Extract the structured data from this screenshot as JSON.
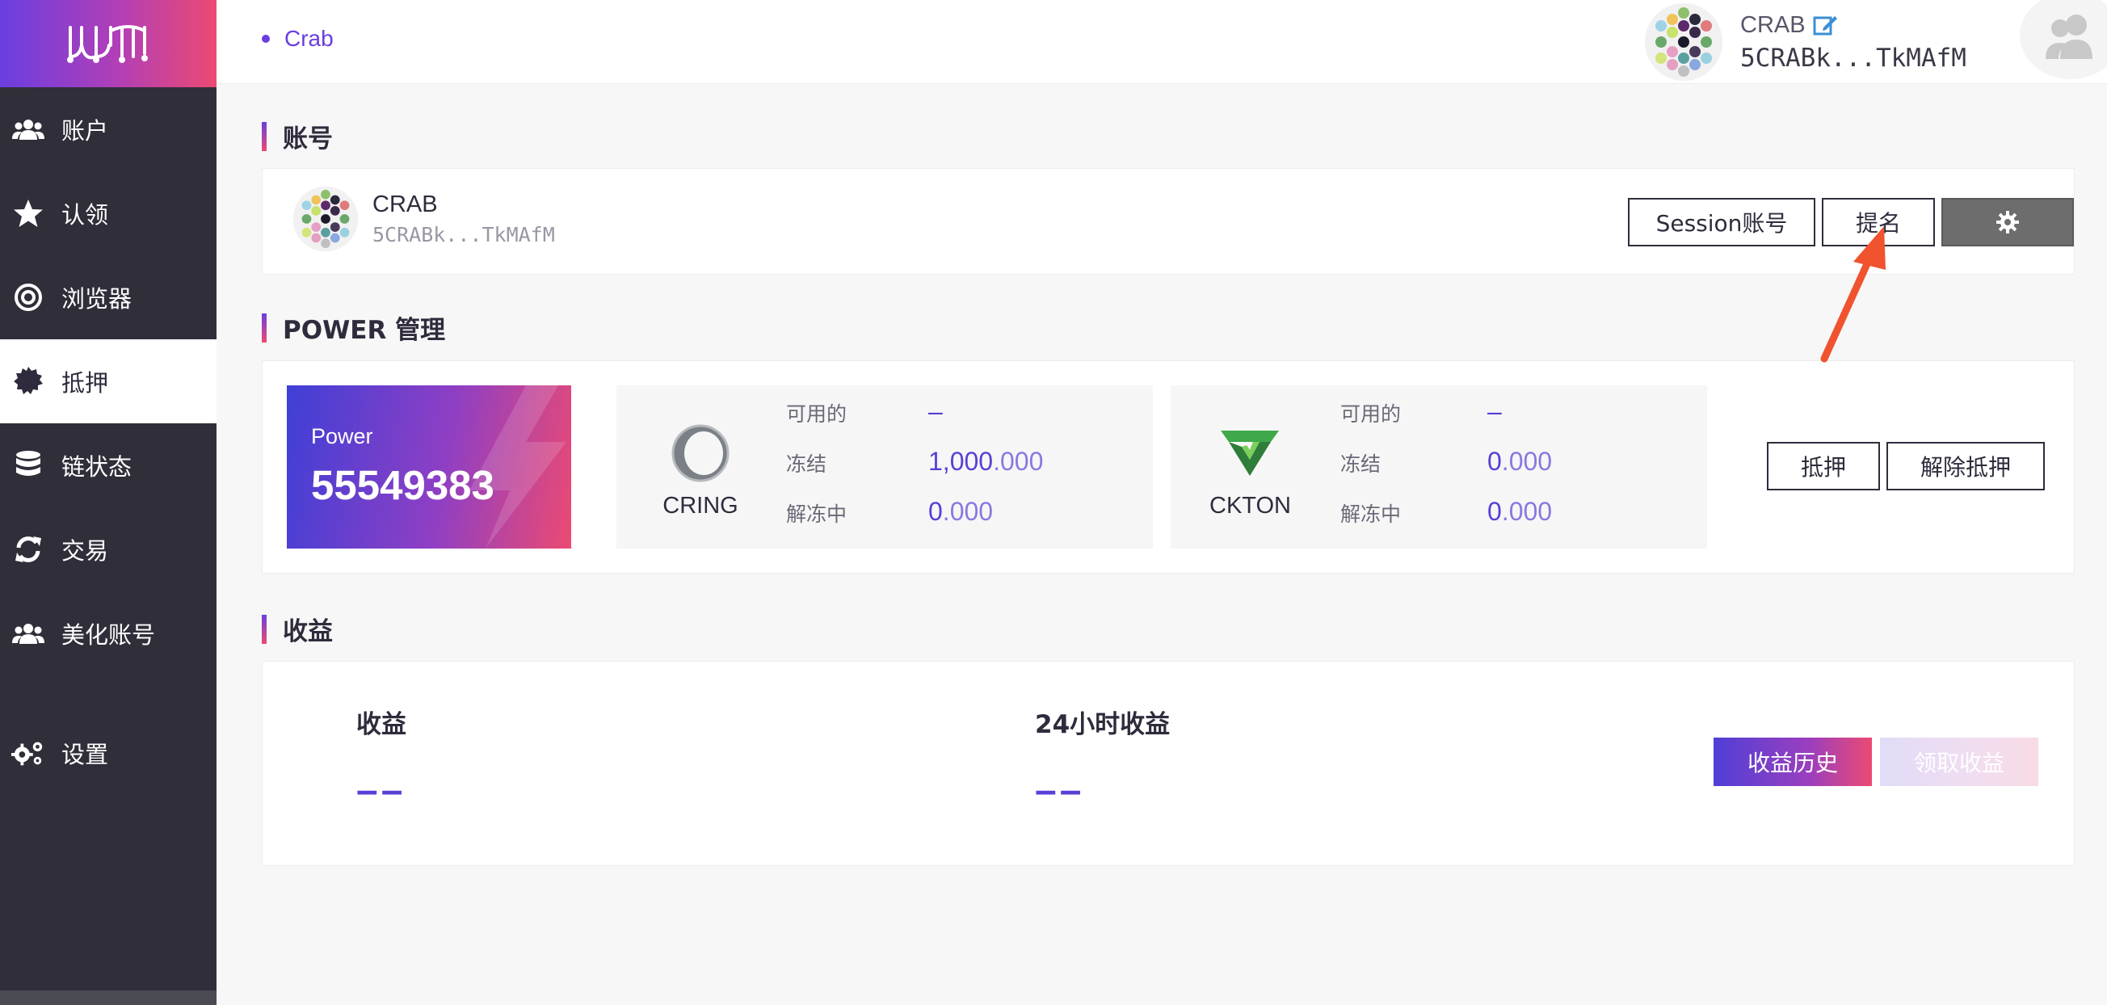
{
  "sidebar": {
    "items": [
      {
        "label": "账户",
        "icon": "users-icon"
      },
      {
        "label": "认领",
        "icon": "star-icon"
      },
      {
        "label": "浏览器",
        "icon": "target-icon"
      },
      {
        "label": "抵押",
        "icon": "badge-icon"
      },
      {
        "label": "链状态",
        "icon": "database-icon"
      },
      {
        "label": "交易",
        "icon": "refresh-icon"
      },
      {
        "label": "美化账号",
        "icon": "users-icon"
      },
      {
        "label": "设置",
        "icon": "gears-icon"
      }
    ],
    "active_index": 3
  },
  "header": {
    "breadcrumb": "Crab",
    "account_name": "CRAB",
    "account_address": "5CRABk...TkMAfM"
  },
  "account_section": {
    "title": "账号",
    "name": "CRAB",
    "address": "5CRABk...TkMAfM",
    "session_button": "Session账号",
    "nominate_button": "提名"
  },
  "power_section": {
    "title": "POWER 管理",
    "power_label": "Power",
    "power_value": "55549383",
    "tokens": [
      {
        "name": "CRING",
        "available_label": "可用的",
        "available_value": "–",
        "bonded_label": "冻结",
        "bonded_int": "1,000",
        "bonded_dec": ".000",
        "unbonding_label": "解冻中",
        "unbonding_int": "0",
        "unbonding_dec": ".000"
      },
      {
        "name": "CKTON",
        "available_label": "可用的",
        "available_value": "–",
        "bonded_label": "冻结",
        "bonded_int": "0",
        "bonded_dec": ".000",
        "unbonding_label": "解冻中",
        "unbonding_int": "0",
        "unbonding_dec": ".000"
      }
    ],
    "bond_button": "抵押",
    "unbond_button": "解除抵押"
  },
  "earnings_section": {
    "title": "收益",
    "earnings_label": "收益",
    "earnings_value": "––",
    "daily_label": "24小时收益",
    "daily_value": "––",
    "history_button": "收益历史",
    "claim_button": "领取收益"
  },
  "colors": {
    "accent": "#6a3ee0",
    "accent_pink": "#ec4a72",
    "sidebar_bg": "#2f2e39",
    "value_purple": "#5a3fd6",
    "annotation_arrow": "#f0532d"
  }
}
